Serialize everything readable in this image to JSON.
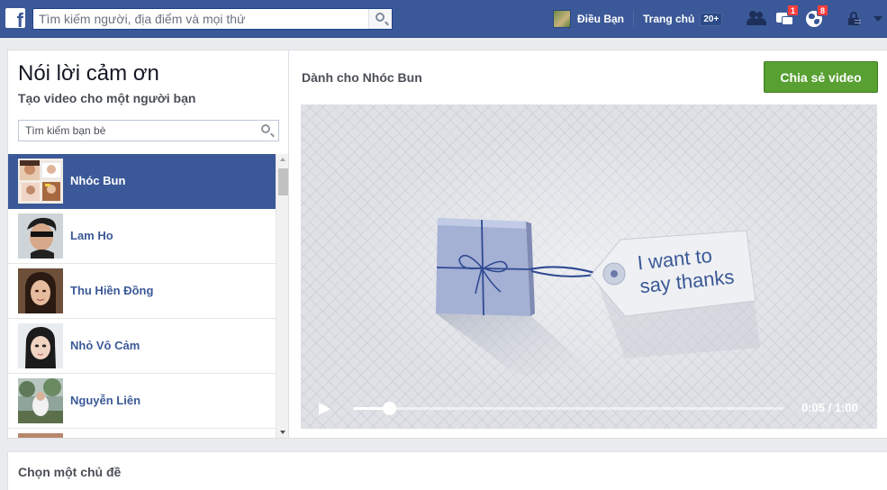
{
  "topbar": {
    "search_placeholder": "Tìm kiếm người, địa điểm và mọi thứ",
    "user_name": "Điều Bạn",
    "home_label": "Trang chủ",
    "home_count": "20+",
    "message_badge": "1",
    "notification_badge": "8",
    "icons": [
      "facebook-logo-icon",
      "search-icon",
      "friends-icon",
      "messages-icon",
      "notifications-icon",
      "privacy-lock-icon",
      "caret-down-icon"
    ]
  },
  "left_panel": {
    "title": "Nói lời cảm ơn",
    "subtitle": "Tạo video cho một người bạn",
    "search_placeholder": "Tìm kiếm bạn bè",
    "friends": [
      {
        "name": "Nhóc Bun",
        "selected": true
      },
      {
        "name": "Lam Ho",
        "selected": false
      },
      {
        "name": "Thu Hiền Đồng",
        "selected": false
      },
      {
        "name": "Nhỏ Vô Cảm",
        "selected": false
      },
      {
        "name": "Nguyễn Liên",
        "selected": false
      },
      {
        "name": "",
        "selected": false
      }
    ]
  },
  "right_panel": {
    "for_label": "Dành cho Nhóc Bun",
    "share_label": "Chia sẻ video",
    "share_color": "#58a032",
    "video": {
      "tag_text_line1": "I want to",
      "tag_text_line2": "say thanks",
      "current_time": "0:05",
      "duration": "1:00",
      "time_display": "0:05 / 1:00",
      "progress_fraction": 0.0833
    }
  },
  "bottom_panel": {
    "title": "Chọn một chủ đề"
  },
  "colors": {
    "brand": "#3b5998",
    "badge": "#fa3e3e",
    "background": "#e9ebee"
  }
}
